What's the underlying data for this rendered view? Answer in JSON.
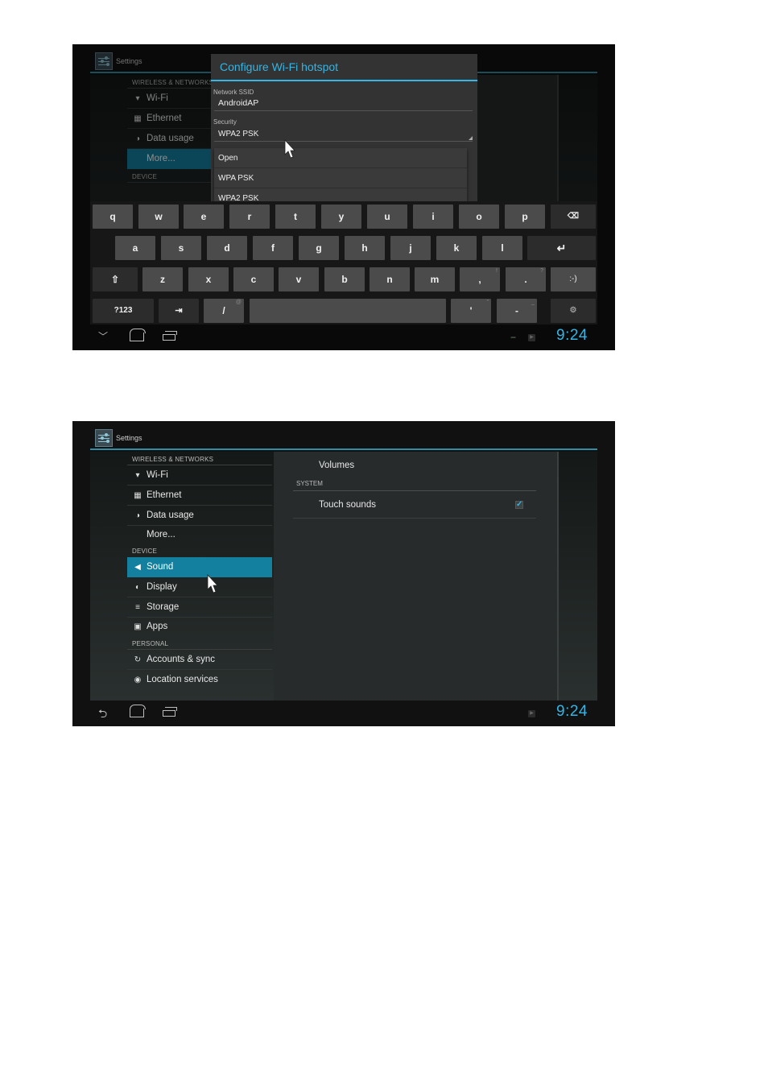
{
  "screen1": {
    "app_title": "Settings",
    "background_list": {
      "category_wireless": "WIRELESS & NETWORKS",
      "items": [
        {
          "label": "Wi-Fi",
          "icon": "wifi-icon"
        },
        {
          "label": "Ethernet",
          "icon": "ethernet-icon"
        },
        {
          "label": "Data usage",
          "icon": "data-usage-icon"
        },
        {
          "label": "More...",
          "icon": ""
        }
      ],
      "category_device": "DEVICE"
    },
    "dialog": {
      "title": "Configure Wi-Fi hotspot",
      "ssid_label": "Network SSID",
      "ssid_value": "AndroidAP",
      "security_label": "Security",
      "security_value": "WPA2 PSK",
      "options": [
        "Open",
        "WPA PSK",
        "WPA2 PSK"
      ]
    },
    "keyboard": {
      "row1": [
        "q",
        "w",
        "e",
        "r",
        "t",
        "y",
        "u",
        "i",
        "o",
        "p"
      ],
      "row2": [
        "a",
        "s",
        "d",
        "f",
        "g",
        "h",
        "j",
        "k",
        "l"
      ],
      "row3": [
        "z",
        "x",
        "c",
        "v",
        "b",
        "n",
        "m"
      ],
      "comma": ",",
      "comma_alt": "!",
      "period": ".",
      "period_alt": "?",
      "smiley": ":-)",
      "symbols": "?123",
      "tab": "⇥",
      "slash": "/",
      "slash_alt": "@",
      "apostrophe": "'",
      "apostrophe_alt": "\"",
      "dash": "-",
      "dash_alt": "_",
      "backspace": "⌫",
      "enter": "↵",
      "shift": "⇧",
      "settings": "⚙"
    },
    "clock": "9:24"
  },
  "screen2": {
    "app_title": "Settings",
    "sidebar": {
      "categories": [
        "WIRELESS & NETWORKS",
        "DEVICE",
        "PERSONAL"
      ],
      "wireless": [
        {
          "label": "Wi-Fi",
          "icon": "wifi-icon",
          "glyph": "▾"
        },
        {
          "label": "Ethernet",
          "icon": "ethernet-icon",
          "glyph": "▦"
        },
        {
          "label": "Data usage",
          "icon": "data-usage-icon",
          "glyph": "◑"
        },
        {
          "label": "More...",
          "icon": "",
          "glyph": ""
        }
      ],
      "device": [
        {
          "label": "Sound",
          "icon": "speaker-icon",
          "glyph": "◀",
          "selected": true
        },
        {
          "label": "Display",
          "icon": "brightness-icon",
          "glyph": "◐"
        },
        {
          "label": "Storage",
          "icon": "storage-icon",
          "glyph": "≡"
        },
        {
          "label": "Apps",
          "icon": "apps-icon",
          "glyph": "▣"
        }
      ],
      "personal": [
        {
          "label": "Accounts & sync",
          "icon": "sync-icon",
          "glyph": "↻"
        },
        {
          "label": "Location services",
          "icon": "location-icon",
          "glyph": "◉"
        }
      ]
    },
    "detail": {
      "volumes": "Volumes",
      "system_category": "SYSTEM",
      "touch_sounds": "Touch sounds",
      "touch_sounds_checked": true,
      "check_mark": "✓"
    },
    "clock": "9:24"
  },
  "colors": {
    "accent": "#33b5e5",
    "selected_item": "#13809f",
    "screen_bg": "#111111"
  }
}
